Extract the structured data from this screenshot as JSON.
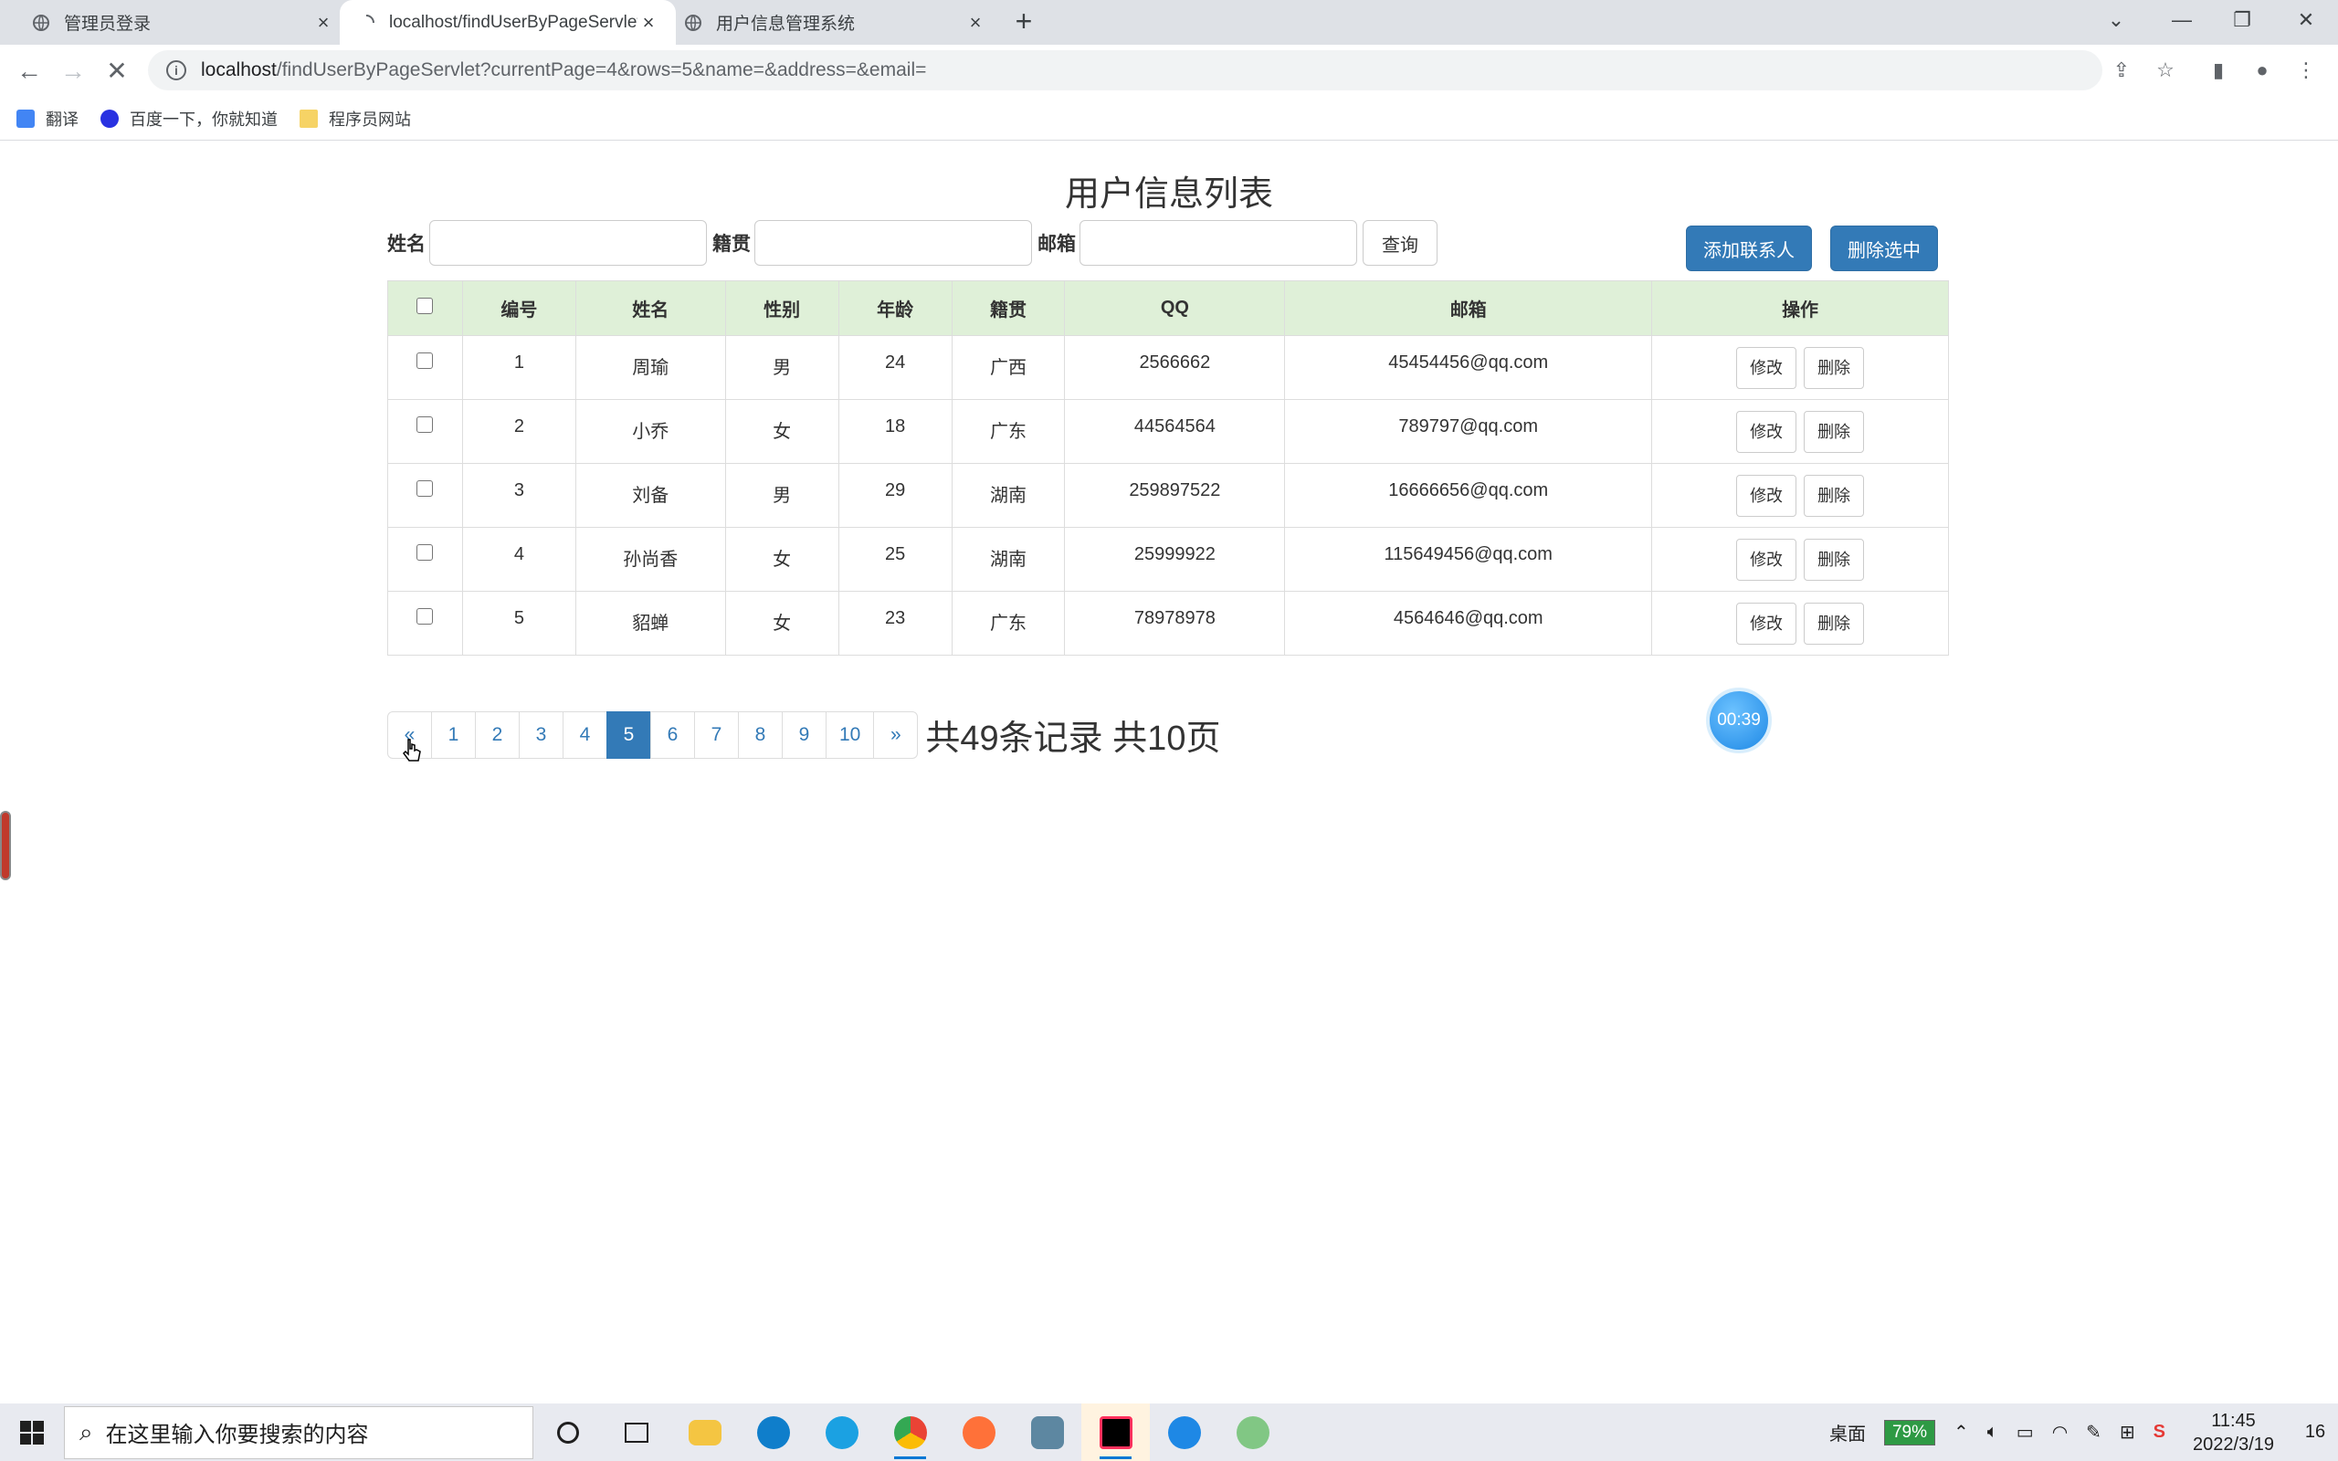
{
  "tabs": [
    {
      "title": "管理员登录",
      "active": false
    },
    {
      "title": "localhost/findUserByPageServlet",
      "active": true
    },
    {
      "title": "用户信息管理系统",
      "active": false
    }
  ],
  "window_controls": {
    "minimize": "—",
    "restore": "❐",
    "close": "✕",
    "tab_search": "⌄"
  },
  "address": {
    "host": "localhost",
    "path": "/findUserByPageServlet?currentPage=4&rows=5&name=&address=&email="
  },
  "bookmarks": [
    {
      "label": "翻译",
      "icon": "translate-icon",
      "color": "#4285f4"
    },
    {
      "label": "百度一下，你就知道",
      "icon": "baidu-paw-icon",
      "color": "#2932e1"
    },
    {
      "label": "程序员网站",
      "icon": "folder-icon",
      "color": "#f6d365"
    }
  ],
  "page": {
    "title": "用户信息列表",
    "search": {
      "name_label": "姓名",
      "address_label": "籍贯",
      "email_label": "邮箱",
      "name_value": "",
      "address_value": "",
      "email_value": "",
      "submit_label": "查询"
    },
    "actions": {
      "add_label": "添加联系人",
      "delete_selected_label": "删除选中"
    },
    "table": {
      "headers": [
        "编号",
        "姓名",
        "性别",
        "年龄",
        "籍贯",
        "QQ",
        "邮箱",
        "操作"
      ],
      "rows": [
        {
          "id": "1",
          "name": "周瑜",
          "gender": "男",
          "age": "24",
          "address": "广西",
          "qq": "2566662",
          "email": "45454456@qq.com"
        },
        {
          "id": "2",
          "name": "小乔",
          "gender": "女",
          "age": "18",
          "address": "广东",
          "qq": "44564564",
          "email": "789797@qq.com"
        },
        {
          "id": "3",
          "name": "刘备",
          "gender": "男",
          "age": "29",
          "address": "湖南",
          "qq": "259897522",
          "email": "16666656@qq.com"
        },
        {
          "id": "4",
          "name": "孙尚香",
          "gender": "女",
          "age": "25",
          "address": "湖南",
          "qq": "25999922",
          "email": "115649456@qq.com"
        },
        {
          "id": "5",
          "name": "貂蝉",
          "gender": "女",
          "age": "23",
          "address": "广东",
          "qq": "78978978",
          "email": "4564646@qq.com"
        }
      ],
      "edit_label": "修改",
      "delete_label": "删除"
    },
    "pagination": {
      "prev": "«",
      "next": "»",
      "pages": [
        "1",
        "2",
        "3",
        "4",
        "5",
        "6",
        "7",
        "8",
        "9",
        "10"
      ],
      "current": "5",
      "summary": "共49条记录 共10页"
    },
    "timer": "00:39"
  },
  "taskbar": {
    "search_placeholder": "在这里输入你要搜索的内容",
    "desktop_label": "桌面",
    "battery": "79%",
    "time": "11:45",
    "date": "2022/3/19",
    "notifications": "16"
  },
  "colors": {
    "primary": "#337ab7",
    "table_header": "#dff0d8",
    "tab_strip": "#dee1e6"
  }
}
